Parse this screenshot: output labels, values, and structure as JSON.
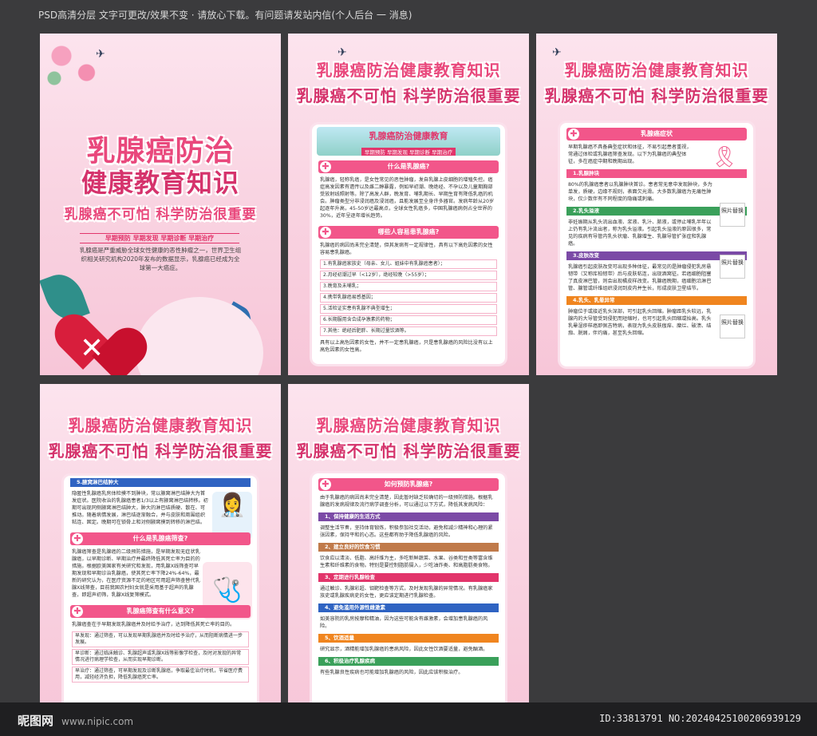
{
  "header": {
    "notice": "PSD高清分层 文字可更改/效果不变 · 请放心下载。有问题请发站内信(个人后台 一 消息)"
  },
  "footer": {
    "brand": "昵图网",
    "site": "www.nipic.com",
    "id": "ID:33813791 NO:20240425100206939129"
  },
  "common": {
    "title1": "乳腺癌防治健康教育知识",
    "title2": "乳腺癌不可怕 科学防治很重要",
    "photo": "照片替换"
  },
  "poster1": {
    "line1": "乳腺癌防治",
    "line2": "健康教育知识",
    "line3": "乳腺癌不可怕 科学防治很重要",
    "tags": "早期预防 早期发现 早期诊断 早期治疗",
    "intro": "乳腺癌是严重威胁全球女性健康的恶性肿瘤之一，世界卫生组织相关研究机构2020年发布的数据显示，乳腺癌已经成为全球第一大癌症。"
  },
  "poster2": {
    "banner": "乳腺癌防治健康教育",
    "banner_sub": "早期预防 早期发现 早期诊断 早期治疗",
    "sec1": "什么是乳腺癌?",
    "p1": "乳腺癌，轻称乳癌，是女性常见的恶性肿瘤，发自乳腺上皮细胞的增殖失控。癌症高发因素有遗传以及雌二醇暴露，例如早初潮、晚绝经、不孕以及儿童期胸部受放射线照射等。除了高发人群，晚发育、哺乳期长、早期生育有降低乳癌的机会。肿瘤类型分非浸润癌及浸润癌，且能发展至全身许多器官。发病年龄从20岁起逐年升高，45-50岁达最高点，全球女性乳癌多，中国乳腺癌病例占全世界的30%，近年呈逐年增长趋势。",
    "sec2": "哪些人容易患乳腺癌?",
    "p2": "乳腺癌的病因尚未完全清楚，但其发病有一定规律性，具有以下高危因素的女性容易患乳腺癌。",
    "items": [
      "1.有乳腺癌家族史（母亲、女儿、姐妹中有乳腺癌患者）；",
      "2.月经初潮过早（<12岁），绝经较晚（>55岁）；",
      "3.晚育及未哺乳；",
      "4.携带乳腺癌易感基因；",
      "5.活检证实患有乳腺不典型增生；",
      "6.长期服用含合成孕激素的药物；",
      "7.其他：绝经后肥胖、长期过量饮酒等。"
    ],
    "p3": "具有以上高危因素的女性，并不一定患乳腺癌，只是患乳腺癌的风险比没有以上高危因素的女性高。"
  },
  "poster3": {
    "sec": "乳腺癌症状",
    "intro": "早期乳腺癌不具备典型症状和体征，不易引起患者重视，常通过体检或乳腺癌筛查发现。以下为乳腺癌的典型体征，多在癌症中期和晚期出现。",
    "bars": [
      {
        "label": "1.乳腺肿块",
        "text": "80%的乳腺癌患者以乳腺肿块首诊。患者常无意中发现肿块，多为单发，质硬，边缘不规则，表面欠光滑。大多数乳腺癌为无痛性肿块，仅少数伴有不同程度的隐痛或刺痛。"
      },
      {
        "label": "2.乳头溢液",
        "text": "非妊娠期从乳头流出血液、浆液、乳汁、脓液，或停止哺乳半年以上仍有乳汁流出者，称为乳头溢液。引起乳头溢液的原因很多，常见的疾病有导管内乳头状瘤、乳腺增生、乳腺导管扩张症和乳腺癌。"
      },
      {
        "label": "3.皮肤改变",
        "text": "乳腺癌引起皮肤改变可出现多种体征，最常见的是肿瘤侵犯乳房悬韧带（又称库柏韧带）后与皮肤粘连，出现酒窝征。若癌细胞阻塞了真皮淋巴管，则会出现橘皮样改变。乳腺癌晚期，癌细胞沿淋巴管、腺管或纤维组织浸润到皮内并生长，形成皮肤卫星结节。"
      },
      {
        "label": "4.乳头、乳晕异常",
        "text": "肿瘤位于或接近乳头深部，可引起乳头回缩。肿瘤距乳头较远，乳腺内的大导管受到侵犯而短缩时，也可引起乳头回缩或抬高。乳头乳晕湿疹样癌即佩吉特病，表现为乳头皮肤瘙痒、糜烂、破溃、结痂、脱屑，伴灼痛，甚至乳头回缩。"
      }
    ]
  },
  "poster4": {
    "bar1": "5.腋窝淋巴结肿大",
    "p1": "隐匿性乳腺癌乳房体检摸不到肿块，常以腋窝淋巴结肿大为首发症状。医院收治的乳腺癌患者1/3以上有腋窝淋巴结转移。初期可出现同侧腋窝淋巴结肿大，肿大的淋巴结质硬、散在、可推动。随着病情发展，淋巴结逐渐融合，并与皮肤和周围组织粘连、固定。晚期可在锁骨上和对侧腋窝摸到转移的淋巴结。",
    "sec2": "什么是乳腺癌筛查?",
    "p2": "乳腺癌筛查是乳腺癌的二级预防措施，是早期发现无症状乳腺癌，以早期诊断、早期治疗并最终降低其死亡率为目的的措施。根据欧美国家有关研究和发现，用乳腺X线筛查可早期发现和早期诊治乳腺癌，使其死亡率下降24%-64%，最新的研究认为，在医疗资源不足的地区可用超声筛查替代乳腺X线筛查，目前我国农村妇女就是采用基于超声的乳腺查，即超声初筛，乳腺X线复筛模式。",
    "sec3": "乳腺癌筛查有什么意义?",
    "p3": "乳腺癌查在于早期发现乳腺癌并及时给予治疗，达到降低其死亡率的目的。",
    "s1": "早发现：通过筛查，可以发现早期乳腺癌并及时给予治疗，从而阻断病情进一步发展。",
    "s2": "早诊断：通过临床触诊、乳腺超声或乳腺X线等影像学检查，及时对发现的异常情况进行病理学检查，从而实现早期诊断。",
    "s3": "早治疗：通过筛查，可早期发现及诊断乳腺癌，争取最佳治疗时机，节省医疗费用，减轻经济负担，降低乳腺癌死亡率。"
  },
  "poster5": {
    "sec": "如何预防乳腺癌?",
    "intro": "由于乳腺癌的病因尚未完全清楚，因此暂时缺乏较确切的一级预防措施。根据乳腺癌的发病规律及流行病学调查分析，可以通过以下方式，降低其发病风险：",
    "bars": [
      {
        "label": "1、保持健康的生活方式",
        "text": "调整生活节奏，坚持体育锻炼，积极参加社交活动，避免和减少精神和心理的紧张因素，保持平和的心态。这些都有助于降低乳腺癌的风险。",
        "color": "#7b4aa6"
      },
      {
        "label": "2、建立良好的饮食习惯",
        "text": "饮食应以清淡、低脂、高纤维为主，多吃新鲜蔬菜、水果、谷类和豆类等富含维生素和纤维素的食物。特别是要控制脂肪摄入，少吃油炸类、和高脂肪类食物。",
        "color": "#c07a4a"
      },
      {
        "label": "3、定期进行乳腺检查",
        "text": "通过触诊、乳腺彩超、钼靶检查等方式，及时发现乳腺的异常情况。有乳腺癌家族史或乳腺疾病史的女性，更应该定期进行乳腺检查。",
        "color": "#e2356b"
      },
      {
        "label": "4、避免滥用外源性雌激素",
        "text": "如美容院的乳房按摩和精油，因为这些可能含有雌激素，会增加患乳腺癌的风险。",
        "color": "#2f63c2"
      },
      {
        "label": "5、饮酒适量",
        "text": "研究显示，酒精能增加乳腺癌的患病风险，因此女性饮酒要适量，避免酗酒。",
        "color": "#f0851f"
      },
      {
        "label": "6、积极治疗乳腺疾病",
        "text": "有些乳腺良性疾病也可能增加乳腺癌的风险，因此应该积极治疗。",
        "color": "#3aa05a"
      }
    ]
  }
}
